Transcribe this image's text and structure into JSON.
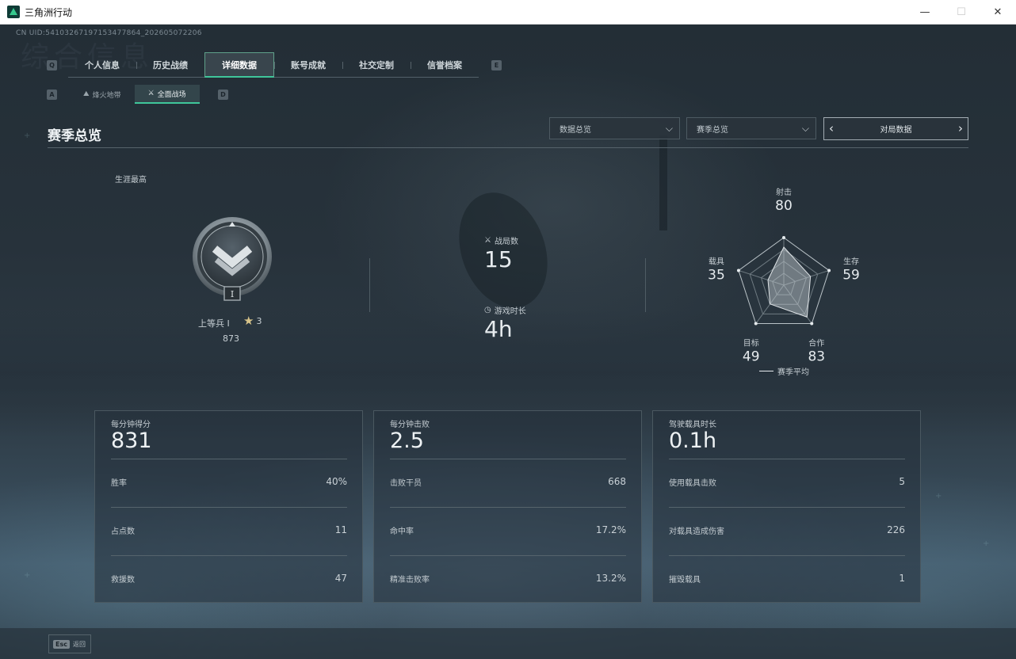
{
  "window": {
    "title": "三角洲行动",
    "minimize_glyph": "—",
    "maximize_glyph": "☐",
    "close_glyph": "✕"
  },
  "uid": "CN UID:5410326719715347786​4_202605072206",
  "ghost_title": "综合信息",
  "keycaps": {
    "q": "Q",
    "e": "E",
    "a": "A",
    "d": "D"
  },
  "main_tabs": [
    {
      "label": "个人信息"
    },
    {
      "label": "历史战绩"
    },
    {
      "label": "详细数据"
    },
    {
      "label": "账号成就"
    },
    {
      "label": "社交定制"
    },
    {
      "label": "信誉档案"
    }
  ],
  "sub_tabs": [
    {
      "label": "烽火地带",
      "icon": "mountain-icon"
    },
    {
      "label": "全面战场",
      "icon": "crosshair-icon"
    }
  ],
  "section": {
    "title": "赛季总览",
    "dropdown_1": "数据总览",
    "dropdown_2": "赛季总览",
    "nav_label": "对局数据"
  },
  "rank": {
    "career_label": "生涯最高",
    "name": "上等兵 I",
    "badge_numeral": "I",
    "stars": "3",
    "score": "873"
  },
  "overview": {
    "matches_label": "战局数",
    "matches_value": "15",
    "playtime_label": "游戏时长",
    "playtime_value": "4h"
  },
  "radar": {
    "legend": "赛季平均",
    "axes": [
      {
        "label": "射击",
        "value": "80",
        "level": 0.8
      },
      {
        "label": "生存",
        "value": "59",
        "level": 0.59
      },
      {
        "label": "合作",
        "value": "83",
        "level": 0.83
      },
      {
        "label": "目标",
        "value": "49",
        "level": 0.49
      },
      {
        "label": "载具",
        "value": "35",
        "level": 0.35
      }
    ]
  },
  "cards": [
    {
      "title": "每分钟得分",
      "value": "831",
      "rows": [
        {
          "label": "胜率",
          "value": "40%"
        },
        {
          "label": "占点数",
          "value": "11"
        },
        {
          "label": "救援数",
          "value": "47"
        }
      ]
    },
    {
      "title": "每分钟击败",
      "value": "2.5",
      "rows": [
        {
          "label": "击败干员",
          "value": "668"
        },
        {
          "label": "命中率",
          "value": "17.2%"
        },
        {
          "label": "精准击败率",
          "value": "13.2%"
        }
      ]
    },
    {
      "title": "驾驶载具时长",
      "value": "0.1h",
      "rows": [
        {
          "label": "使用载具击败",
          "value": "5"
        },
        {
          "label": "对载具造成伤害",
          "value": "226"
        },
        {
          "label": "摧毁载具",
          "value": "1"
        }
      ]
    }
  ],
  "footer": {
    "esc_key": "Esc",
    "back_label": "返回"
  },
  "colors": {
    "accent": "#3fc69a",
    "panel_border": "#4a5860",
    "text": "#c9d1d6"
  }
}
